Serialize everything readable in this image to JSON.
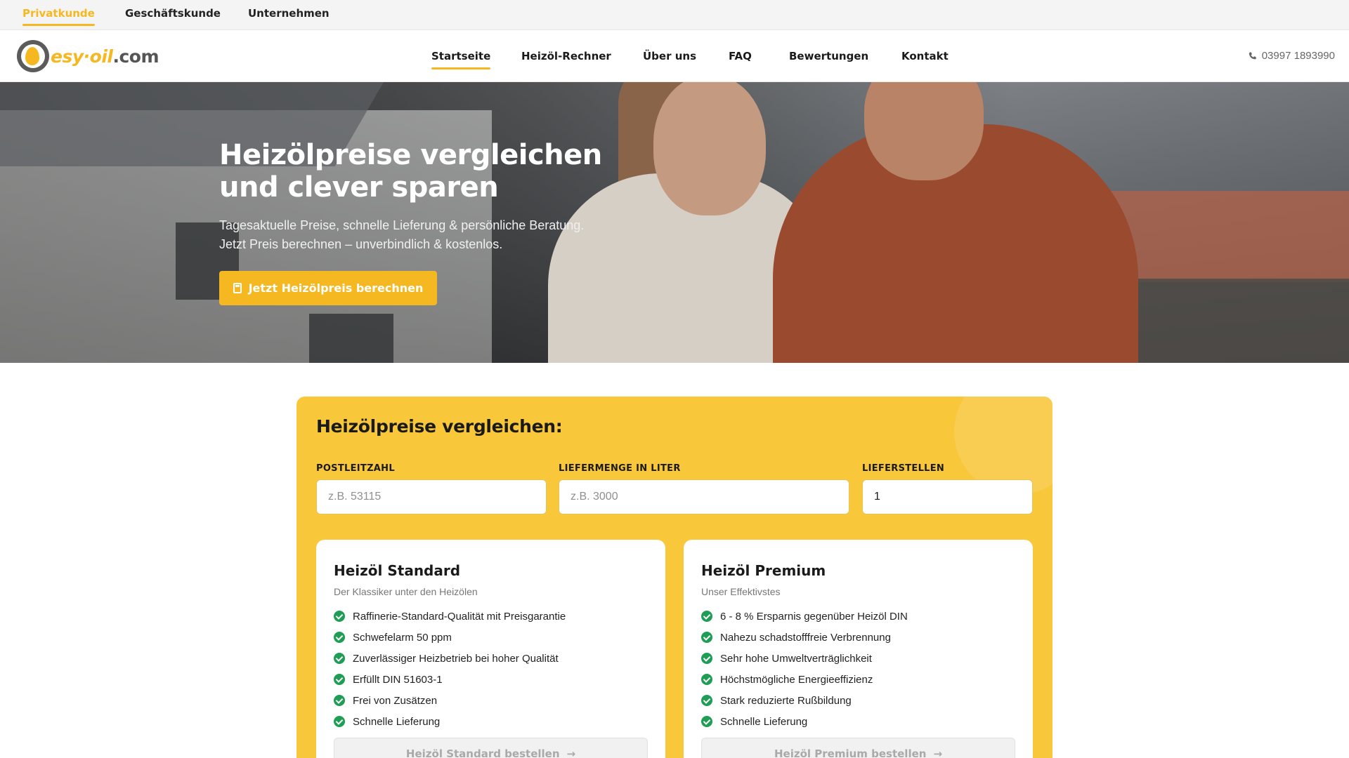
{
  "topbar": {
    "customer_types": [
      {
        "label": "Privatkunde",
        "active": true
      },
      {
        "label": "Geschäftskunde",
        "active": false
      },
      {
        "label": "Unternehmen",
        "active": false
      }
    ]
  },
  "header": {
    "logo": {
      "part1": "esy",
      "part2": "oil",
      "part3": ".com"
    },
    "nav": [
      {
        "label": "Startseite",
        "active": true
      },
      {
        "label": "Heizöl-Rechner",
        "active": false
      },
      {
        "label": "Über uns",
        "active": false
      },
      {
        "label": "FAQ",
        "active": false
      },
      {
        "label": "Bewertungen",
        "active": false
      },
      {
        "label": "Kontakt",
        "active": false
      }
    ],
    "phone": "03997 1893990",
    "phone_icon": "phone-icon"
  },
  "hero": {
    "title_line1": "Heizölpreise vergleichen",
    "title_line2": "und clever sparen",
    "subtitle_line1": "Tagesaktuelle Preise, schnelle Lieferung & persönliche Beratung.",
    "subtitle_line2": "Jetzt Preis berechnen – unverbindlich & kostenlos.",
    "cta_label": "Jetzt Heizölpreis berechnen",
    "cta_icon": "calculator-icon"
  },
  "comparison": {
    "title": "Heizölpreise vergleichen:",
    "fields": {
      "plz": {
        "label": "POSTLEITZAHL",
        "placeholder": "z.B. 53115",
        "value": ""
      },
      "menge": {
        "label": "LIEFERMENGE IN LITER",
        "placeholder": "z.B. 3000",
        "value": ""
      },
      "stellen": {
        "label": "LIEFERSTELLEN",
        "value": "1"
      }
    },
    "products": [
      {
        "title": "Heizöl Standard",
        "subtitle": "Der Klassiker unter den Heizölen",
        "features": [
          "Raffinerie-Standard-Qualität mit Preisgarantie",
          "Schwefelarm 50 ppm",
          "Zuverlässiger Heizbetrieb bei hoher Qualität",
          "Erfüllt DIN 51603-1",
          "Frei von Zusätzen",
          "Schnelle Lieferung"
        ],
        "button": "Heizöl Standard bestellen",
        "button_arrow": "→"
      },
      {
        "title": "Heizöl Premium",
        "subtitle": "Unser Effektivstes",
        "features": [
          "6 - 8 % Ersparnis gegenüber Heizöl DIN",
          "Nahezu schadstofffreie Verbrennung",
          "Sehr hohe Umweltverträglichkeit",
          "Höchstmögliche Energieeffizienz",
          "Stark reduzierte Rußbildung",
          "Schnelle Lieferung"
        ],
        "button": "Heizöl Premium bestellen",
        "button_arrow": "→"
      }
    ]
  },
  "colors": {
    "accent": "#f6b820",
    "panel": "#f9c73a",
    "check": "#1f9d55"
  }
}
